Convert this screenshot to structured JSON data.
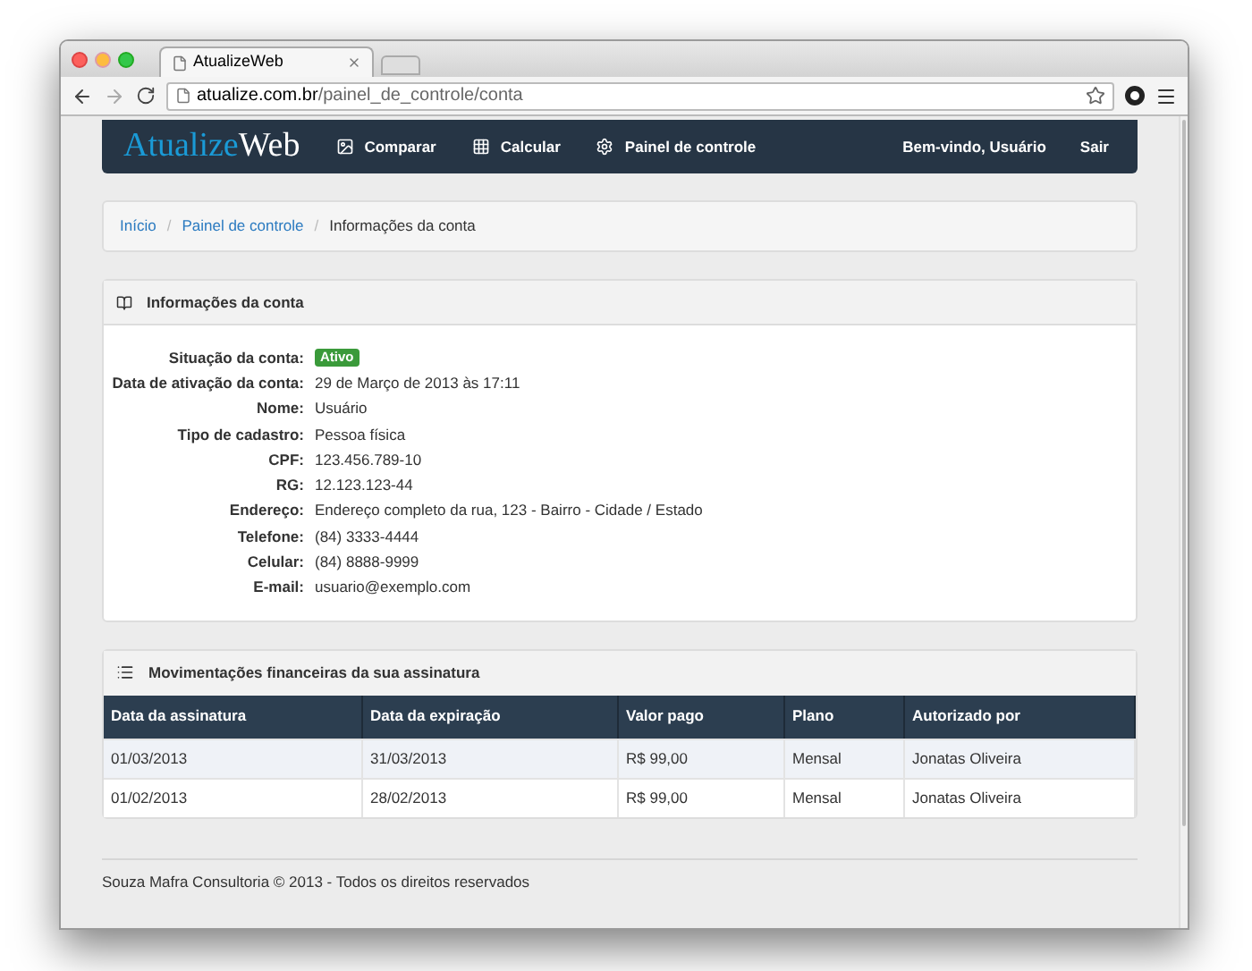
{
  "browser": {
    "tab_title": "AtualizeWeb",
    "url_host": "atualize.com.br",
    "url_path": "/painel_de_controle/conta"
  },
  "navbar": {
    "brand_first": "Atualize",
    "brand_second": "Web",
    "items": [
      {
        "label": "Comparar",
        "kind": "picture"
      },
      {
        "label": "Calcular",
        "kind": "grid"
      },
      {
        "label": "Painel de controle",
        "kind": "gear"
      }
    ],
    "welcome": "Bem-vindo, Usuário",
    "logout": "Sair"
  },
  "breadcrumb_separators": [
    "/",
    "/"
  ],
  "breadcrumb": [
    {
      "label": "Início",
      "link": true
    },
    {
      "label": "Painel de controle",
      "link": true
    },
    {
      "label": "Informações da conta",
      "link": false
    }
  ],
  "account_panel": {
    "title": "Informações da conta",
    "fields": [
      {
        "label": "Situação da conta:",
        "value": "Ativo",
        "kind": "badge"
      },
      {
        "label": "Data de ativação da conta:",
        "value": "29 de Março de 2013 às 17:11",
        "kind": "text"
      },
      {
        "label": "Nome:",
        "value": "Usuário",
        "kind": "text"
      },
      {
        "label": "Tipo de cadastro:",
        "value": "Pessoa física",
        "kind": "text"
      },
      {
        "label": "CPF:",
        "value": "123.456.789-10",
        "kind": "text"
      },
      {
        "label": "RG:",
        "value": "12.123.123-44",
        "kind": "text"
      },
      {
        "label": "Endereço:",
        "value": "Endereço completo da rua, 123 - Bairro - Cidade / Estado",
        "kind": "text"
      },
      {
        "label": "Telefone:",
        "value": "(84) 3333-4444",
        "kind": "text"
      },
      {
        "label": "Celular:",
        "value": "(84) 8888-9999",
        "kind": "text"
      },
      {
        "label": "E-mail:",
        "value": "usuario@exemplo.com",
        "kind": "text"
      }
    ]
  },
  "payments_panel": {
    "title": "Movimentações financeiras da sua assinatura",
    "table": {
      "columns": [
        "Data da assinatura",
        "Data da expiração",
        "Valor pago",
        "Plano",
        "Autorizado por"
      ],
      "rows": [
        [
          "01/03/2013",
          "31/03/2013",
          "R$ 99,00",
          "Mensal",
          "Jonatas Oliveira"
        ],
        [
          "01/02/2013",
          "28/02/2013",
          "R$ 99,00",
          "Mensal",
          "Jonatas Oliveira"
        ]
      ]
    }
  },
  "footer": "Souza Mafra Consultoria © 2013 - Todos os direitos reservados"
}
